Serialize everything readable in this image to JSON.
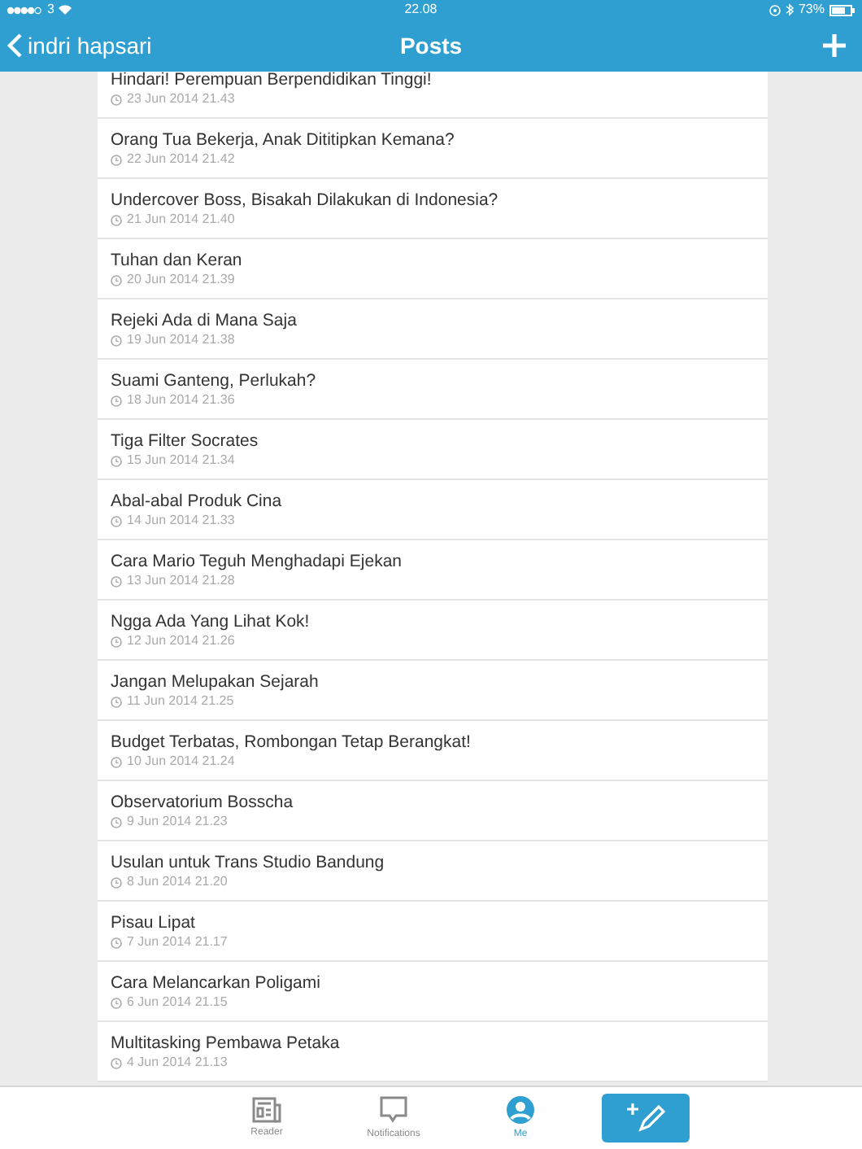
{
  "status_bar": {
    "carrier": "3",
    "time": "22.08",
    "battery": "73%"
  },
  "nav_bar": {
    "back_label": "indri hapsari",
    "title": "Posts"
  },
  "posts": [
    {
      "title": "Hindari! Perempuan Berpendidikan Tinggi!",
      "date": "23 Jun 2014 21.43"
    },
    {
      "title": "Orang Tua Bekerja, Anak Dititipkan Kemana?",
      "date": "22 Jun 2014 21.42"
    },
    {
      "title": "Undercover Boss, Bisakah Dilakukan di Indonesia?",
      "date": "21 Jun 2014 21.40"
    },
    {
      "title": "Tuhan dan Keran",
      "date": "20 Jun 2014 21.39"
    },
    {
      "title": "Rejeki Ada di Mana Saja",
      "date": "19 Jun 2014 21.38"
    },
    {
      "title": "Suami Ganteng, Perlukah?",
      "date": "18 Jun 2014 21.36"
    },
    {
      "title": "Tiga Filter Socrates",
      "date": "15 Jun 2014 21.34"
    },
    {
      "title": "Abal-abal Produk Cina",
      "date": "14 Jun 2014 21.33"
    },
    {
      "title": "Cara Mario Teguh Menghadapi Ejekan",
      "date": "13 Jun 2014 21.28"
    },
    {
      "title": "Ngga Ada Yang Lihat Kok!",
      "date": "12 Jun 2014 21.26"
    },
    {
      "title": "Jangan Melupakan Sejarah",
      "date": "11 Jun 2014 21.25"
    },
    {
      "title": "Budget Terbatas, Rombongan Tetap Berangkat!",
      "date": "10 Jun 2014 21.24"
    },
    {
      "title": "Observatorium Bosscha",
      "date": "9 Jun 2014 21.23"
    },
    {
      "title": "Usulan untuk Trans Studio Bandung",
      "date": "8 Jun 2014 21.20"
    },
    {
      "title": "Pisau Lipat",
      "date": "7 Jun 2014 21.17"
    },
    {
      "title": "Cara Melancarkan Poligami",
      "date": "6 Jun 2014 21.15"
    },
    {
      "title": "Multitasking Pembawa Petaka",
      "date": "4 Jun 2014 21.13"
    }
  ],
  "tab_bar": [
    {
      "kind": "reader",
      "label": "Reader",
      "selected": false
    },
    {
      "kind": "notifications",
      "label": "Notifications",
      "selected": false
    },
    {
      "kind": "me",
      "label": "Me",
      "selected": true
    },
    {
      "kind": "compose",
      "selected": false
    }
  ]
}
